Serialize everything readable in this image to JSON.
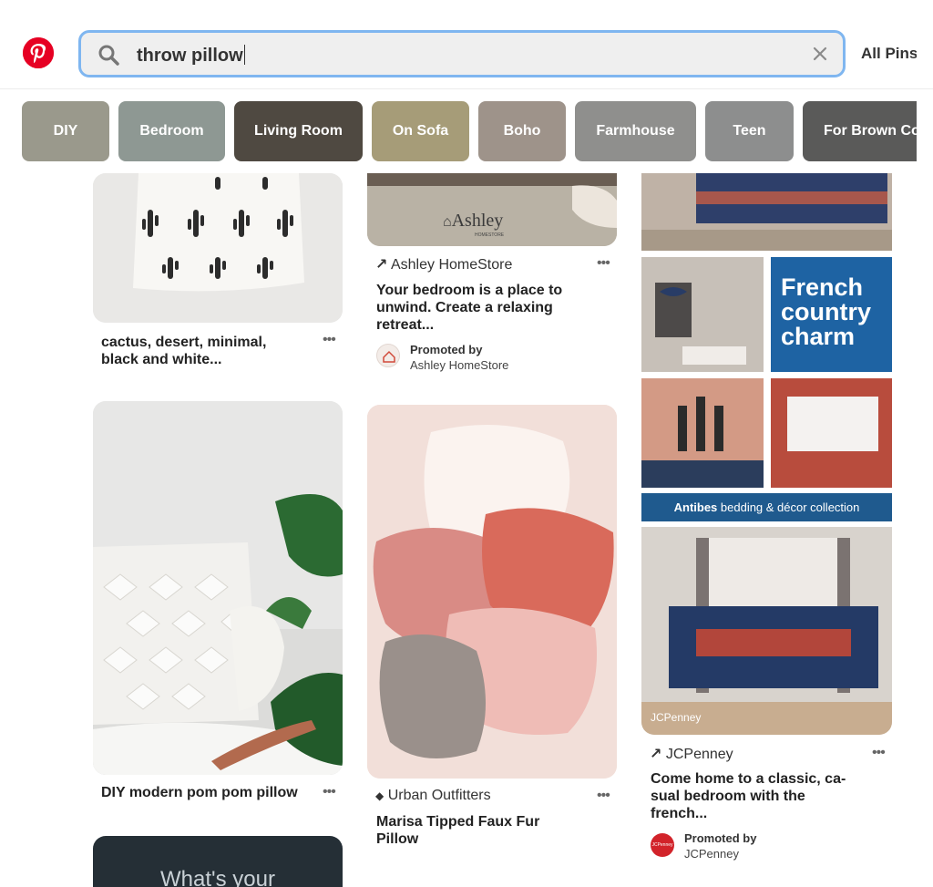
{
  "search": {
    "query": "throw pillow",
    "scope_label": "All Pins"
  },
  "chips": [
    {
      "label": "DIY",
      "color": "#9a998c"
    },
    {
      "label": "Bedroom",
      "color": "#8e9893"
    },
    {
      "label": "Living Room",
      "color": "#4f4941"
    },
    {
      "label": "On Sofa",
      "color": "#a69c78"
    },
    {
      "label": "Boho",
      "color": "#9e938a"
    },
    {
      "label": "Farmhouse",
      "color": "#8f8f8d"
    },
    {
      "label": "Teen",
      "color": "#8d8e8e"
    },
    {
      "label": "For Brown Couch",
      "color": "#5a5a59"
    }
  ],
  "pins": {
    "cactus": {
      "caption": "cactus, desert, minimal, black and white..."
    },
    "ashley": {
      "watermark": "Ashley",
      "watermark_sub": "HOMESTORE",
      "source": "Ashley HomeStore",
      "title": "Your bedroom is a place to unwind. Create a relaxing retreat...",
      "promoted_label": "Promoted by",
      "promoted_by": "Ashley HomeStore"
    },
    "jcp": {
      "french_text": "French country charm",
      "banner": {
        "brand": "Antibes",
        "rest": " bedding & décor collection"
      },
      "watermark": "JCPenney",
      "source": "JCPenney",
      "title": "Come home to a classic, ca-sual bedroom with the french...",
      "promoted_label": "Promoted by",
      "promoted_by": "JCPenney",
      "logo_text": "JCPenney"
    },
    "pompom": {
      "caption": "DIY modern pom pom pillow"
    },
    "urban": {
      "source": "Urban Outfitters",
      "title": "Marisa Tipped Faux Fur Pillow"
    },
    "next_card": {
      "text": "What's your"
    }
  },
  "colors": {
    "brand_red": "#e60023",
    "search_border": "#7fb6f0",
    "jcp_banner": "#1f5a8e",
    "french_panel": "#1e63a3"
  }
}
